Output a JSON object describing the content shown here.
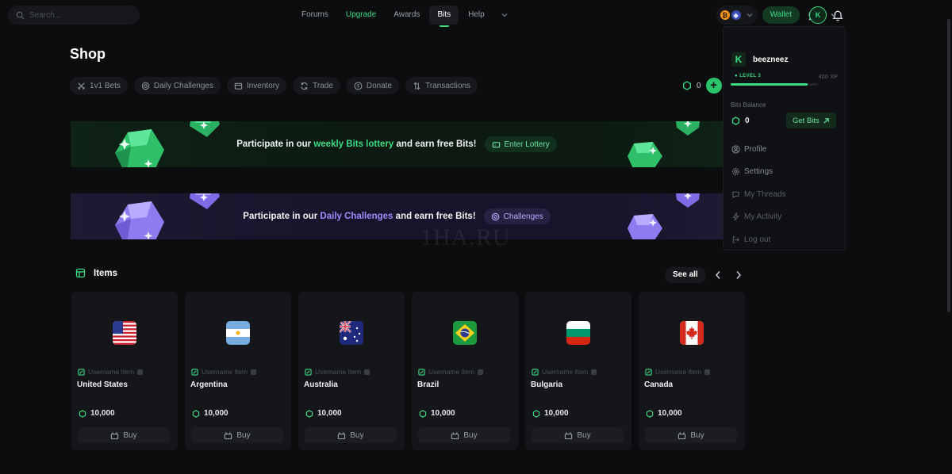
{
  "search": {
    "placeholder": "Search..."
  },
  "nav": {
    "items": [
      {
        "label": "Forums"
      },
      {
        "label": "Upgrade"
      },
      {
        "label": "Awards"
      },
      {
        "label": "Bits"
      },
      {
        "label": "Help"
      }
    ]
  },
  "header": {
    "crypto_icons": [
      "btc-icon",
      "eth-icon"
    ],
    "wallet_label": "Wallet",
    "avatar_letter": "K"
  },
  "page": {
    "title": "Shop"
  },
  "subnav": {
    "items": [
      {
        "label": "1v1 Bets",
        "icon": "swords-icon"
      },
      {
        "label": "Daily Challenges",
        "icon": "target-icon"
      },
      {
        "label": "Inventory",
        "icon": "box-icon"
      },
      {
        "label": "Trade",
        "icon": "refresh-icon"
      },
      {
        "label": "Donate",
        "icon": "dollar-icon"
      },
      {
        "label": "Transactions",
        "icon": "sort-icon"
      }
    ],
    "balance": "0"
  },
  "banners": {
    "lottery": {
      "prefix": "Participate in our",
      "highlight": "weekly Bits lottery",
      "suffix": "and earn free Bits!",
      "button": "Enter Lottery"
    },
    "challenges": {
      "prefix": "Participate in our",
      "highlight": "Daily Challenges",
      "suffix": "and earn free Bits!",
      "button": "Challenges"
    }
  },
  "items": {
    "title": "Items",
    "see_all": "See all",
    "cards": [
      {
        "type": "Username Item",
        "name": "United States",
        "price": "10,000",
        "buy": "Buy",
        "flag": "us"
      },
      {
        "type": "Username Item",
        "name": "Argentina",
        "price": "10,000",
        "buy": "Buy",
        "flag": "ar"
      },
      {
        "type": "Username Item",
        "name": "Australia",
        "price": "10,000",
        "buy": "Buy",
        "flag": "au"
      },
      {
        "type": "Username Item",
        "name": "Brazil",
        "price": "10,000",
        "buy": "Buy",
        "flag": "br"
      },
      {
        "type": "Username Item",
        "name": "Bulgaria",
        "price": "10,000",
        "buy": "Buy",
        "flag": "bg"
      },
      {
        "type": "Username Item",
        "name": "Canada",
        "price": "10,000",
        "buy": "Buy",
        "flag": "ca"
      }
    ]
  },
  "dropdown": {
    "logo_letter": "K",
    "username": "beezneez",
    "level": "LEVEL 3",
    "xp": "400 XP",
    "xp_progress": 0.88,
    "bits_balance_label": "Bits Balance",
    "bits_balance": "0",
    "get_bits_label": "Get Bits",
    "menu": [
      {
        "label": "Profile",
        "icon": "user-icon"
      },
      {
        "label": "Settings",
        "icon": "gear-icon"
      },
      {
        "label": "My Threads",
        "icon": "chat-icon"
      },
      {
        "label": "My Activity",
        "icon": "bolt-icon"
      },
      {
        "label": "Log out",
        "icon": "logout-icon"
      }
    ]
  },
  "watermark": "1HA.RU",
  "colors": {
    "accent": "#3ddc84",
    "purple": "#9d8cff",
    "background": "#0c0d0f",
    "card": "#15161a"
  }
}
